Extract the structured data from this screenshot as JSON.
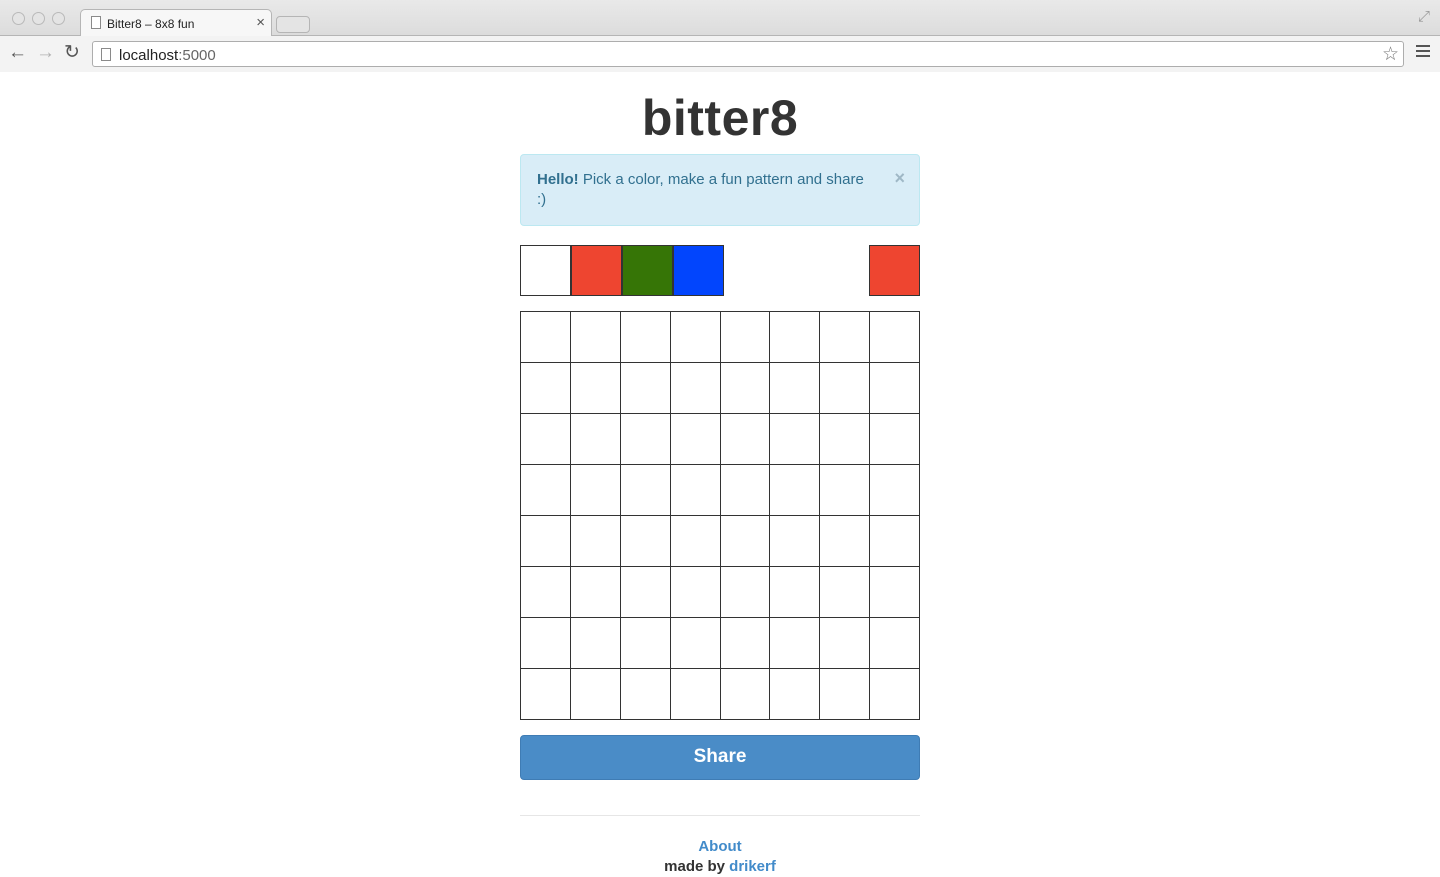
{
  "browser": {
    "tab_title": "Bitter8 – 8x8 fun",
    "url_host": "localhost",
    "url_port": ":5000"
  },
  "page": {
    "title": "bitter8",
    "alert": {
      "strong": "Hello!",
      "text": " Pick a color, make a fun pattern and share :)",
      "close": "×"
    },
    "palette": {
      "swatches": [
        "#ffffff",
        "#ee4530",
        "#367506",
        "#0245fd"
      ],
      "selected_color": "#ee4530"
    },
    "grid": {
      "rows": 8,
      "cols": 8,
      "cell_color": "#ffffff"
    },
    "share_label": "Share",
    "footer": {
      "about": "About",
      "made_by": "made by ",
      "author": "drikerf"
    }
  }
}
